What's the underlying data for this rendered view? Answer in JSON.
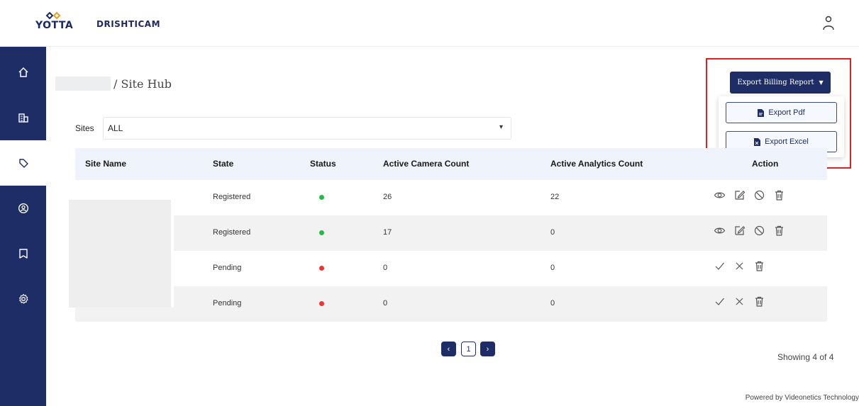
{
  "brand": {
    "logo_text": "YOTTA",
    "app_name": "DRISHTICAM"
  },
  "header": {
    "user_icon": "user-icon"
  },
  "sidebar": {
    "items": [
      {
        "icon": "home-icon",
        "active": false
      },
      {
        "icon": "building-icon",
        "active": false
      },
      {
        "icon": "tag-icon",
        "active": true
      },
      {
        "icon": "user-circle-icon",
        "active": false
      },
      {
        "icon": "bookmark-icon",
        "active": false
      },
      {
        "icon": "settings-icon",
        "active": false
      }
    ]
  },
  "breadcrumb": {
    "current": "/ Site Hub"
  },
  "export": {
    "main_label": "Export Billing Report",
    "pdf_label": "Export Pdf",
    "excel_label": "Export Excel"
  },
  "filter": {
    "label": "Sites",
    "value": "ALL"
  },
  "table": {
    "columns": [
      "Site Name",
      "State",
      "Status",
      "Active Camera Count",
      "Active Analytics Count",
      "Action"
    ],
    "rows": [
      {
        "state": "Registered",
        "status_color": "#22bb44",
        "camera_count": "26",
        "analytics_count": "22",
        "actions": [
          "eye-icon",
          "edit-icon",
          "block-icon",
          "trash-icon"
        ]
      },
      {
        "state": "Registered",
        "status_color": "#22bb44",
        "camera_count": "17",
        "analytics_count": "0",
        "actions": [
          "eye-icon",
          "edit-icon",
          "block-icon",
          "trash-icon"
        ]
      },
      {
        "state": "Pending",
        "status_color": "#ee3333",
        "camera_count": "0",
        "analytics_count": "0",
        "actions": [
          "check-icon",
          "close-icon",
          "trash-icon"
        ]
      },
      {
        "state": "Pending",
        "status_color": "#ee3333",
        "camera_count": "0",
        "analytics_count": "0",
        "actions": [
          "check-icon",
          "close-icon",
          "trash-icon"
        ]
      }
    ]
  },
  "pagination": {
    "current_page": "1",
    "prev": "‹",
    "next": "›"
  },
  "showing": "Showing 4 of 4",
  "footer": "Powered by Videonetics Technology",
  "colors": {
    "primary": "#1e2d66",
    "highlight": "#e02020",
    "registered": "#22bb44",
    "pending": "#ee3333"
  }
}
